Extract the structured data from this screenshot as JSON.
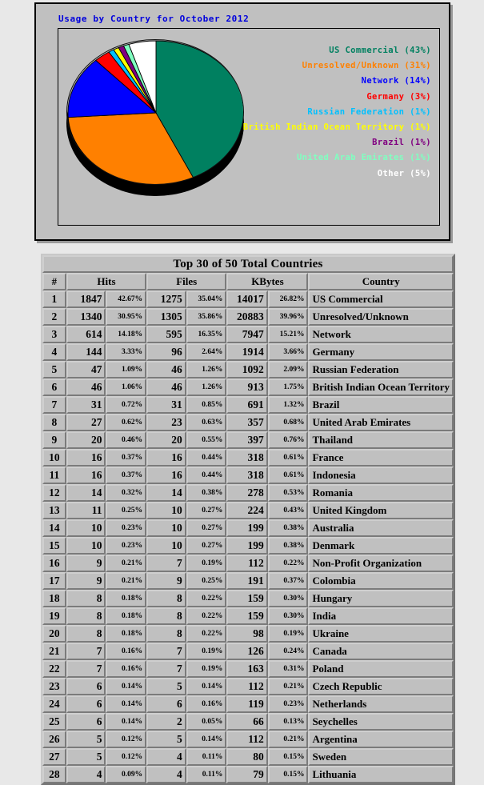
{
  "chart": {
    "title": "Usage by Country for October 2012",
    "legend": [
      {
        "label": "US Commercial (43%)",
        "color": "#008060",
        "percent": 43
      },
      {
        "label": "Unresolved/Unknown (31%)",
        "color": "#ff8000",
        "percent": 31
      },
      {
        "label": "Network (14%)",
        "color": "#0000ff",
        "percent": 14
      },
      {
        "label": "Germany (3%)",
        "color": "#ff0000",
        "percent": 3
      },
      {
        "label": "Russian Federation (1%)",
        "color": "#00c0ff",
        "percent": 1
      },
      {
        "label": "British Indian Ocean Territory (1%)",
        "color": "#ffff00",
        "percent": 1
      },
      {
        "label": "Brazil (1%)",
        "color": "#800080",
        "percent": 1
      },
      {
        "label": "United Arab Emirates (1%)",
        "color": "#80ffc0",
        "percent": 1
      },
      {
        "label": "Other (5%)",
        "color": "#ffffff",
        "percent": 5
      }
    ]
  },
  "chart_data": {
    "type": "pie",
    "title": "Usage by Country for October 2012",
    "labels": [
      "US Commercial",
      "Unresolved/Unknown",
      "Network",
      "Germany",
      "Russian Federation",
      "British Indian Ocean Territory",
      "Brazil",
      "United Arab Emirates",
      "Other"
    ],
    "values": [
      43,
      31,
      14,
      3,
      1,
      1,
      1,
      1,
      5
    ],
    "value_unit": "percent",
    "colors": [
      "#008060",
      "#ff8000",
      "#0000ff",
      "#ff0000",
      "#00c0ff",
      "#ffff00",
      "#800080",
      "#80ffc0",
      "#ffffff"
    ],
    "legend_position": "right",
    "three_d": true,
    "grid": false
  },
  "table": {
    "title": "Top 30 of 50 Total Countries",
    "headers": {
      "rank": "#",
      "hits": "Hits",
      "files": "Files",
      "kbytes": "KBytes",
      "country": "Country"
    },
    "header_colors": {
      "hits": "#007f3f",
      "files": "#0f6fff",
      "kbytes": "#ff0000",
      "country": "#00ffff"
    },
    "rows": [
      {
        "rank": "1",
        "hits": "1847",
        "hits_pct": "42.67%",
        "files": "1275",
        "files_pct": "35.04%",
        "kbytes": "14017",
        "kbytes_pct": "26.82%",
        "country": "US Commercial"
      },
      {
        "rank": "2",
        "hits": "1340",
        "hits_pct": "30.95%",
        "files": "1305",
        "files_pct": "35.86%",
        "kbytes": "20883",
        "kbytes_pct": "39.96%",
        "country": "Unresolved/Unknown"
      },
      {
        "rank": "3",
        "hits": "614",
        "hits_pct": "14.18%",
        "files": "595",
        "files_pct": "16.35%",
        "kbytes": "7947",
        "kbytes_pct": "15.21%",
        "country": "Network"
      },
      {
        "rank": "4",
        "hits": "144",
        "hits_pct": "3.33%",
        "files": "96",
        "files_pct": "2.64%",
        "kbytes": "1914",
        "kbytes_pct": "3.66%",
        "country": "Germany"
      },
      {
        "rank": "5",
        "hits": "47",
        "hits_pct": "1.09%",
        "files": "46",
        "files_pct": "1.26%",
        "kbytes": "1092",
        "kbytes_pct": "2.09%",
        "country": "Russian Federation"
      },
      {
        "rank": "6",
        "hits": "46",
        "hits_pct": "1.06%",
        "files": "46",
        "files_pct": "1.26%",
        "kbytes": "913",
        "kbytes_pct": "1.75%",
        "country": "British Indian Ocean Territory"
      },
      {
        "rank": "7",
        "hits": "31",
        "hits_pct": "0.72%",
        "files": "31",
        "files_pct": "0.85%",
        "kbytes": "691",
        "kbytes_pct": "1.32%",
        "country": "Brazil"
      },
      {
        "rank": "8",
        "hits": "27",
        "hits_pct": "0.62%",
        "files": "23",
        "files_pct": "0.63%",
        "kbytes": "357",
        "kbytes_pct": "0.68%",
        "country": "United Arab Emirates"
      },
      {
        "rank": "9",
        "hits": "20",
        "hits_pct": "0.46%",
        "files": "20",
        "files_pct": "0.55%",
        "kbytes": "397",
        "kbytes_pct": "0.76%",
        "country": "Thailand"
      },
      {
        "rank": "10",
        "hits": "16",
        "hits_pct": "0.37%",
        "files": "16",
        "files_pct": "0.44%",
        "kbytes": "318",
        "kbytes_pct": "0.61%",
        "country": "France"
      },
      {
        "rank": "11",
        "hits": "16",
        "hits_pct": "0.37%",
        "files": "16",
        "files_pct": "0.44%",
        "kbytes": "318",
        "kbytes_pct": "0.61%",
        "country": "Indonesia"
      },
      {
        "rank": "12",
        "hits": "14",
        "hits_pct": "0.32%",
        "files": "14",
        "files_pct": "0.38%",
        "kbytes": "278",
        "kbytes_pct": "0.53%",
        "country": "Romania"
      },
      {
        "rank": "13",
        "hits": "11",
        "hits_pct": "0.25%",
        "files": "10",
        "files_pct": "0.27%",
        "kbytes": "224",
        "kbytes_pct": "0.43%",
        "country": "United Kingdom"
      },
      {
        "rank": "14",
        "hits": "10",
        "hits_pct": "0.23%",
        "files": "10",
        "files_pct": "0.27%",
        "kbytes": "199",
        "kbytes_pct": "0.38%",
        "country": "Australia"
      },
      {
        "rank": "15",
        "hits": "10",
        "hits_pct": "0.23%",
        "files": "10",
        "files_pct": "0.27%",
        "kbytes": "199",
        "kbytes_pct": "0.38%",
        "country": "Denmark"
      },
      {
        "rank": "16",
        "hits": "9",
        "hits_pct": "0.21%",
        "files": "7",
        "files_pct": "0.19%",
        "kbytes": "112",
        "kbytes_pct": "0.22%",
        "country": "Non-Profit Organization"
      },
      {
        "rank": "17",
        "hits": "9",
        "hits_pct": "0.21%",
        "files": "9",
        "files_pct": "0.25%",
        "kbytes": "191",
        "kbytes_pct": "0.37%",
        "country": "Colombia"
      },
      {
        "rank": "18",
        "hits": "8",
        "hits_pct": "0.18%",
        "files": "8",
        "files_pct": "0.22%",
        "kbytes": "159",
        "kbytes_pct": "0.30%",
        "country": "Hungary"
      },
      {
        "rank": "19",
        "hits": "8",
        "hits_pct": "0.18%",
        "files": "8",
        "files_pct": "0.22%",
        "kbytes": "159",
        "kbytes_pct": "0.30%",
        "country": "India"
      },
      {
        "rank": "20",
        "hits": "8",
        "hits_pct": "0.18%",
        "files": "8",
        "files_pct": "0.22%",
        "kbytes": "98",
        "kbytes_pct": "0.19%",
        "country": "Ukraine"
      },
      {
        "rank": "21",
        "hits": "7",
        "hits_pct": "0.16%",
        "files": "7",
        "files_pct": "0.19%",
        "kbytes": "126",
        "kbytes_pct": "0.24%",
        "country": "Canada"
      },
      {
        "rank": "22",
        "hits": "7",
        "hits_pct": "0.16%",
        "files": "7",
        "files_pct": "0.19%",
        "kbytes": "163",
        "kbytes_pct": "0.31%",
        "country": "Poland"
      },
      {
        "rank": "23",
        "hits": "6",
        "hits_pct": "0.14%",
        "files": "5",
        "files_pct": "0.14%",
        "kbytes": "112",
        "kbytes_pct": "0.21%",
        "country": "Czech Republic"
      },
      {
        "rank": "24",
        "hits": "6",
        "hits_pct": "0.14%",
        "files": "6",
        "files_pct": "0.16%",
        "kbytes": "119",
        "kbytes_pct": "0.23%",
        "country": "Netherlands"
      },
      {
        "rank": "25",
        "hits": "6",
        "hits_pct": "0.14%",
        "files": "2",
        "files_pct": "0.05%",
        "kbytes": "66",
        "kbytes_pct": "0.13%",
        "country": "Seychelles"
      },
      {
        "rank": "26",
        "hits": "5",
        "hits_pct": "0.12%",
        "files": "5",
        "files_pct": "0.14%",
        "kbytes": "112",
        "kbytes_pct": "0.21%",
        "country": "Argentina"
      },
      {
        "rank": "27",
        "hits": "5",
        "hits_pct": "0.12%",
        "files": "4",
        "files_pct": "0.11%",
        "kbytes": "80",
        "kbytes_pct": "0.15%",
        "country": "Sweden"
      },
      {
        "rank": "28",
        "hits": "4",
        "hits_pct": "0.09%",
        "files": "4",
        "files_pct": "0.11%",
        "kbytes": "79",
        "kbytes_pct": "0.15%",
        "country": "Lithuania"
      }
    ]
  }
}
